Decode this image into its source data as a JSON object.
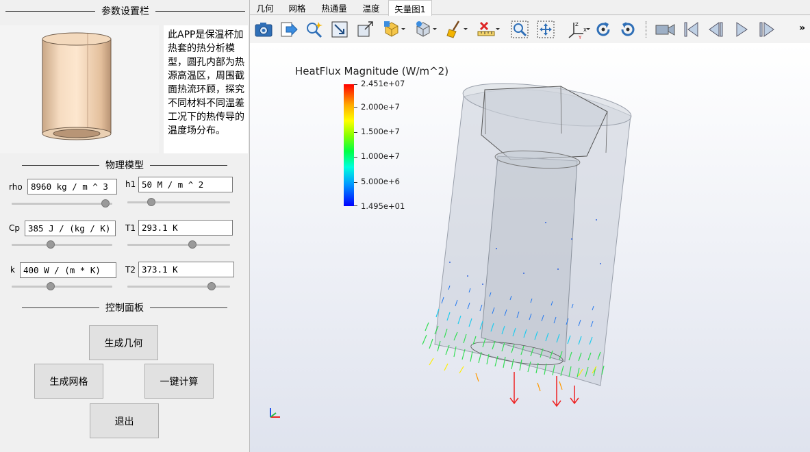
{
  "left": {
    "param_title": "参数设置栏",
    "description": "此APP是保温杯加热套的热分析模型，圆孔内部为热源高温区，周围截面热流环顾，探究不同材料不同温差工况下的热传导的温度场分布。",
    "physics_title": "物理模型",
    "control_title": "控制面板",
    "params": {
      "rho": {
        "label": "rho",
        "value": "8960 kg / m ^ 3",
        "slider": 0.93
      },
      "h1": {
        "label": "h1",
        "value": "50 M / m ^ 2",
        "slider": 0.23
      },
      "cp": {
        "label": "Cp",
        "value": "385 J / (kg / K)",
        "slider": 0.39
      },
      "t1": {
        "label": "T1",
        "value": "293.1 K",
        "slider": 0.63
      },
      "k": {
        "label": "k",
        "value": "400 W / (m * K)",
        "slider": 0.39
      },
      "t2": {
        "label": "T2",
        "value": "373.1 K",
        "slider": 0.82
      }
    },
    "buttons": {
      "geometry": "生成几何",
      "mesh": "生成网格",
      "compute": "一键计算",
      "exit": "退出"
    }
  },
  "tabs": [
    {
      "label": "几何",
      "active": false
    },
    {
      "label": "网格",
      "active": false
    },
    {
      "label": "热通量",
      "active": false
    },
    {
      "label": "温度",
      "active": false
    },
    {
      "label": "矢量图1",
      "active": true
    }
  ],
  "toolbar": {
    "icons": [
      "camera-icon",
      "export-icon",
      "magic-zoom-icon",
      "zoom-box-icon",
      "box-view-icon",
      "cube-color-icon",
      "cube-options-icon",
      "broom-icon",
      "ruler-icon",
      "zoom-window-icon",
      "pan-icon",
      "axes-icon",
      "rotate-cw-icon",
      "rotate-ccw-icon",
      "record-icon",
      "first-frame-icon",
      "prev-frame-icon",
      "play-icon",
      "last-frame-icon"
    ],
    "more": "»"
  },
  "viewport": {
    "legend_title": "HeatFlux Magnitude (W/m^2)",
    "legend_ticks": [
      "2.451e+07",
      "2.000e+7",
      "1.500e+7",
      "1.000e+7",
      "5.000e+6",
      "1.495e+01"
    ]
  }
}
